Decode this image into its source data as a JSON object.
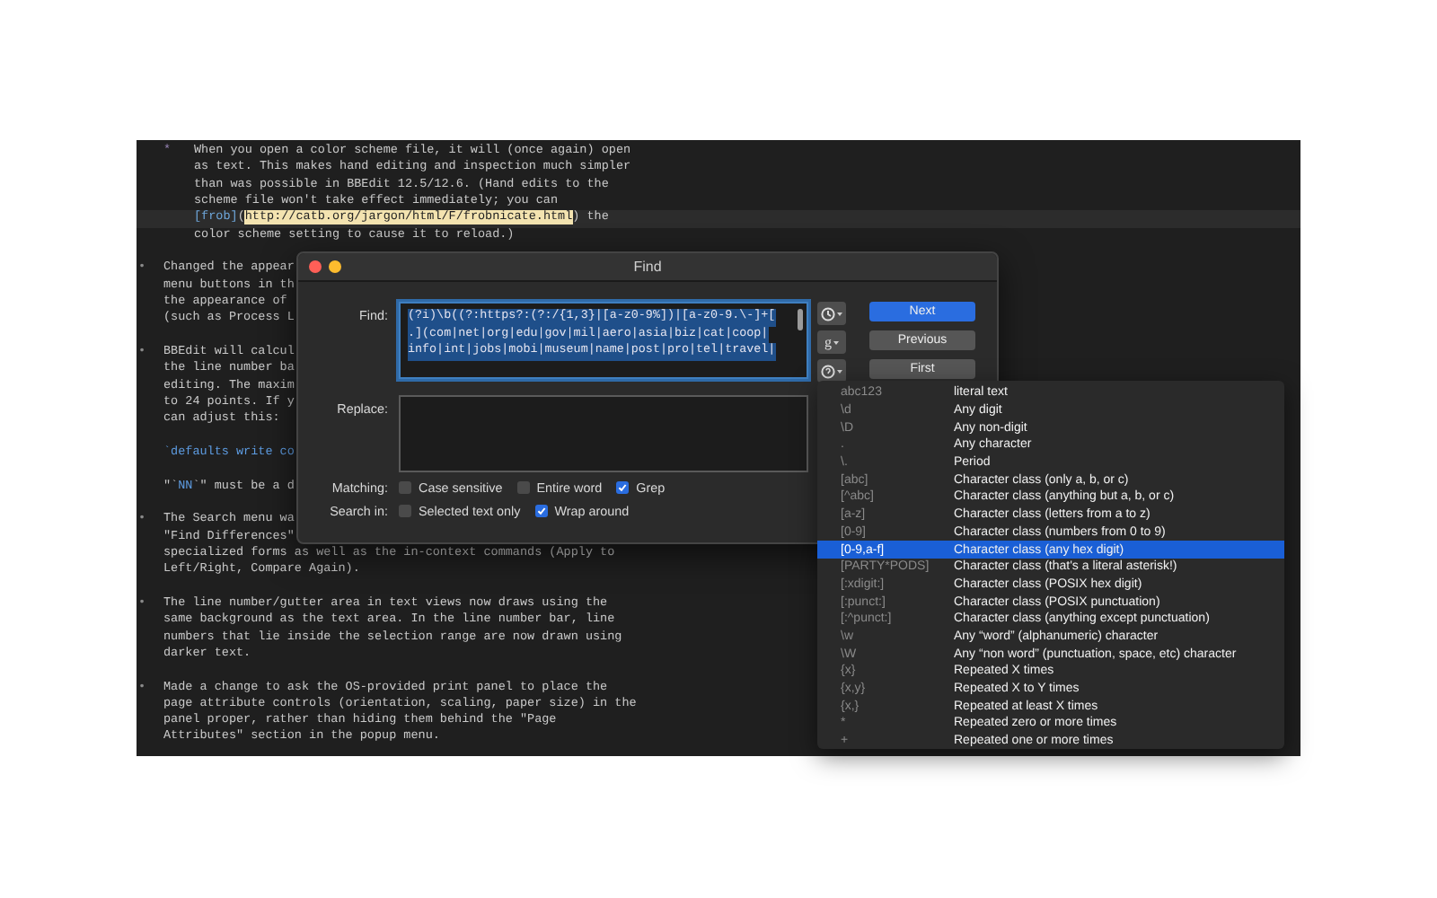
{
  "editor": {
    "paragraphs": [
      {
        "kind": "nested-item",
        "bullet": "*",
        "lines": [
          "When you open a color scheme file, it will (once again) open",
          "as text. This makes hand editing and inspection much simpler",
          "than was possible in BBEdit 12.5/12.6. (Hand edits to the",
          "scheme file won't take effect immediately; you can",
          {
            "current": true,
            "segments": [
              {
                "kind": "link-label",
                "text": "[frob]"
              },
              {
                "kind": "plain",
                "text": "("
              },
              {
                "kind": "url",
                "text": "http://catb.org/jargon/html/F/frobnicate.html"
              },
              {
                "kind": "plain",
                "text": ") the"
              }
            ]
          },
          "color scheme setting to cause it to reload.)"
        ]
      },
      {
        "kind": "item",
        "bullet": "•",
        "lines": [
          "Changed the appear",
          "menu buttons in th",
          "the appearance of",
          "(such as Process L"
        ]
      },
      {
        "kind": "item",
        "bullet": "•",
        "lines": [
          "BBEdit will calcul",
          "the line number ba",
          "editing. The maxim",
          "to 24 points. If y",
          "can adjust this:"
        ]
      },
      {
        "kind": "plain",
        "lines": [
          {
            "segments": [
              {
                "kind": "code",
                "text": "`defaults write co"
              }
            ]
          }
        ]
      },
      {
        "kind": "plain",
        "lines": [
          {
            "segments": [
              {
                "kind": "plain",
                "text": "\"`"
              },
              {
                "kind": "code",
                "text": "NN"
              },
              {
                "kind": "plain",
                "text": "`\" must be a d"
              }
            ]
          }
        ]
      },
      {
        "kind": "item",
        "bullet": "•",
        "lines": [
          "The Search menu wa",
          "\"Find Differences\"",
          "specialized forms as well as the in-context commands (Apply to",
          "Left/Right, Compare Again)."
        ]
      },
      {
        "kind": "item",
        "bullet": "•",
        "lines": [
          "The line number/gutter area in text views now draws using the",
          "same background as the text area. In the line number bar, line",
          "numbers that lie inside the selection range are now drawn using",
          "darker text."
        ]
      },
      {
        "kind": "item",
        "bullet": "•",
        "lines": [
          "Made a change to ask the OS-provided print panel to place the",
          "page attribute controls (orientation, scaling, paper size) in the",
          "panel proper, rather than hiding them behind the \"Page",
          "Attributes\" section in the popup menu."
        ]
      }
    ]
  },
  "dialog": {
    "title": "Find",
    "find": {
      "label": "Find:",
      "selected": true,
      "lines": [
        "(?i)\\b((?:https?:(?:/{1,3}|[a-z0-9%])|[a-z0-9.\\-]+[",
        ".](com|net|org|edu|gov|mil|aero|asia|biz|cat|coop|",
        "info|int|jobs|mobi|museum|name|post|pro|tel|travel|"
      ]
    },
    "replace": {
      "label": "Replace:"
    },
    "tool_buttons": [
      {
        "kind": "clock"
      },
      {
        "kind": "text",
        "label": "g"
      },
      {
        "kind": "help"
      }
    ],
    "buttons": [
      {
        "label": "Next",
        "default": true
      },
      {
        "label": "Previous",
        "default": false
      },
      {
        "label": "First",
        "default": false
      }
    ],
    "option_rows": [
      {
        "label": "Matching:",
        "options": [
          {
            "label": "Case sensitive",
            "checked": false
          },
          {
            "label": "Entire word",
            "checked": false
          },
          {
            "label": "Grep",
            "checked": true
          }
        ]
      },
      {
        "label": "Search in:",
        "options": [
          {
            "label": "Selected text only",
            "checked": false
          },
          {
            "label": "Wrap around",
            "checked": true
          }
        ]
      }
    ]
  },
  "pattern_menu": {
    "items": [
      {
        "pattern": "abc123",
        "description": "literal text",
        "selected": false
      },
      {
        "pattern": "\\d",
        "description": "Any digit",
        "selected": false
      },
      {
        "pattern": "\\D",
        "description": "Any non-digit",
        "selected": false
      },
      {
        "pattern": ".",
        "description": "Any character",
        "selected": false
      },
      {
        "pattern": "\\.",
        "description": "Period",
        "selected": false
      },
      {
        "pattern": "[abc]",
        "description": "Character class (only a, b, or c)",
        "selected": false
      },
      {
        "pattern": "[^abc]",
        "description": "Character class (anything but a, b, or c)",
        "selected": false
      },
      {
        "pattern": "[a-z]",
        "description": "Character class (letters from a to z)",
        "selected": false
      },
      {
        "pattern": "[0-9]",
        "description": "Character class (numbers from 0 to 9)",
        "selected": false
      },
      {
        "pattern": "[0-9,a-f]",
        "description": "Character class (any hex digit)",
        "selected": true
      },
      {
        "pattern": "[PARTY*PODS]",
        "description": "Character class (that's a literal asterisk!)",
        "selected": false
      },
      {
        "pattern": "[:xdigit:]",
        "description": "Character class (POSIX hex digit)",
        "selected": false
      },
      {
        "pattern": "[:punct:]",
        "description": "Character class (POSIX punctuation)",
        "selected": false
      },
      {
        "pattern": "[:^punct:]",
        "description": "Character class (anything except punctuation)",
        "selected": false
      },
      {
        "pattern": "\\w",
        "description": "Any “word” (alphanumeric) character",
        "selected": false
      },
      {
        "pattern": "\\W",
        "description": "Any “non word” (punctuation, space, etc) character",
        "selected": false
      },
      {
        "pattern": "{x}",
        "description": "Repeated X times",
        "selected": false
      },
      {
        "pattern": "{x,y}",
        "description": "Repeated X to Y times",
        "selected": false
      },
      {
        "pattern": "{x,}",
        "description": "Repeated at least X times",
        "selected": false
      },
      {
        "pattern": "*",
        "description": "Repeated zero or more times",
        "selected": false
      },
      {
        "pattern": "+",
        "description": "Repeated one or more times",
        "selected": false
      }
    ]
  }
}
